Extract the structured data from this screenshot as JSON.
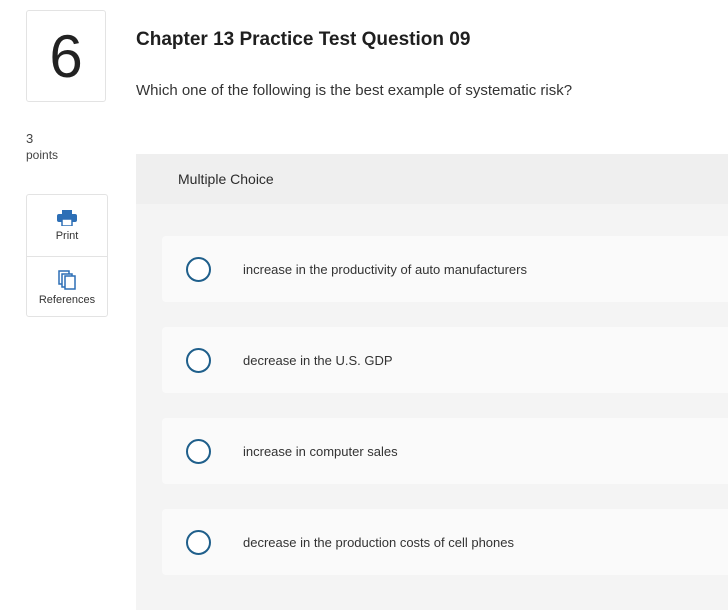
{
  "question_number": "6",
  "points": {
    "value": "3",
    "label": "points"
  },
  "tools": {
    "print_label": "Print",
    "references_label": "References"
  },
  "title": "Chapter 13 Practice Test Question 09",
  "question_text": "Which one of the following is the best example of systematic risk?",
  "answer_type": "Multiple Choice",
  "choices": [
    {
      "label": "increase in the productivity of auto manufacturers",
      "selected": false
    },
    {
      "label": "decrease in the U.S. GDP",
      "selected": false
    },
    {
      "label": "increase in computer sales",
      "selected": false
    },
    {
      "label": "decrease in the production costs of cell phones",
      "selected": false
    }
  ],
  "colors": {
    "radio_border": "#1f5f8b",
    "icon_blue": "#2d6fb6"
  }
}
